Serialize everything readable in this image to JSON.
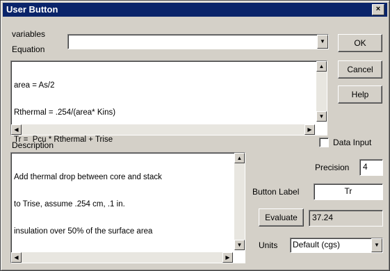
{
  "window": {
    "title": "User Button",
    "close_glyph": "×"
  },
  "variables": {
    "label": "variables",
    "value": ""
  },
  "equation": {
    "label": "Equation",
    "lines": [
      "area = As/2",
      "Rthermal = .254/(area* Kins)",
      "Tr =  Pcu * Rthermal + Trise"
    ]
  },
  "buttons": {
    "ok": "OK",
    "cancel": "Cancel",
    "help": "Help",
    "evaluate": "Evaluate"
  },
  "data_input": {
    "label": "Data Input",
    "checked": false
  },
  "description": {
    "label": "Description",
    "lines": [
      "Add thermal drop between core and stack",
      "to Trise, assume .254 cm, .1 in.",
      "insulation over 50% of the surface area"
    ]
  },
  "precision": {
    "label": "Precision",
    "value": "4"
  },
  "button_label": {
    "label": "Button Label",
    "value": "Tr"
  },
  "evaluate_result": "37.24",
  "units": {
    "label": "Units",
    "selected": "Default (cgs)"
  },
  "icons": {
    "scroll_up": "▲",
    "scroll_down": "▼",
    "scroll_left": "◀",
    "scroll_right": "▶",
    "dropdown": "▼"
  }
}
